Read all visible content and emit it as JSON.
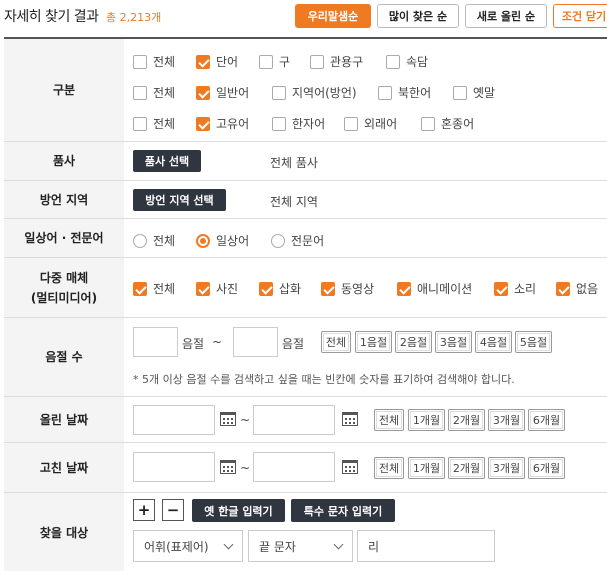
{
  "header": {
    "title": "자세히 찾기 결과",
    "total": "총 2,213개",
    "buttons": [
      "우리말샘순",
      "많이 찾은 순",
      "새로 올린 순",
      "조건 닫기"
    ]
  },
  "category": {
    "label": "구분",
    "row1": [
      {
        "text": "전체",
        "checked": false
      },
      {
        "text": "단어",
        "checked": true
      },
      {
        "text": "구",
        "checked": false
      },
      {
        "text": "관용구",
        "checked": false
      },
      {
        "text": "속담",
        "checked": false
      }
    ],
    "row2": [
      {
        "text": "전체",
        "checked": false
      },
      {
        "text": "일반어",
        "checked": true
      },
      {
        "text": "지역어(방언)",
        "checked": false
      },
      {
        "text": "북한어",
        "checked": false
      },
      {
        "text": "옛말",
        "checked": false
      }
    ],
    "row3": [
      {
        "text": "전체",
        "checked": false
      },
      {
        "text": "고유어",
        "checked": true
      },
      {
        "text": "한자어",
        "checked": false
      },
      {
        "text": "외래어",
        "checked": false
      },
      {
        "text": "혼종어",
        "checked": false
      }
    ]
  },
  "pos": {
    "label": "품사",
    "button": "품사 선택",
    "value": "전체 품사"
  },
  "region": {
    "label": "방언 지역",
    "button": "방언 지역 선택",
    "value": "전체 지역"
  },
  "register": {
    "label": "일상어 · 전문어",
    "options": [
      {
        "text": "전체",
        "selected": false
      },
      {
        "text": "일상어",
        "selected": true
      },
      {
        "text": "전문어",
        "selected": false
      }
    ]
  },
  "multimedia": {
    "label1": "다중 매체",
    "label2": "(멀티미디어)",
    "options": [
      {
        "text": "전체",
        "checked": true
      },
      {
        "text": "사진",
        "checked": true
      },
      {
        "text": "삽화",
        "checked": true
      },
      {
        "text": "동영상",
        "checked": true
      },
      {
        "text": "애니메이션",
        "checked": true
      },
      {
        "text": "소리",
        "checked": true
      },
      {
        "text": "없음",
        "checked": true
      }
    ]
  },
  "syllable": {
    "label": "음절 수",
    "unit": "음절",
    "tilde": "~",
    "chips": [
      "전체",
      "1음절",
      "2음절",
      "3음절",
      "4음절",
      "5음절"
    ],
    "note": "* 5개 이상 음절 수를 검색하고 싶을 때는 빈칸에 숫자를 표기하여 검색해야 합니다."
  },
  "posted": {
    "label": "올린 날짜",
    "tilde": "~",
    "chips": [
      "전체",
      "1개월",
      "2개월",
      "3개월",
      "6개월"
    ]
  },
  "modified": {
    "label": "고친 날짜",
    "tilde": "~",
    "chips": [
      "전체",
      "1개월",
      "2개월",
      "3개월",
      "6개월"
    ]
  },
  "target": {
    "label": "찾을 대상",
    "plus": "+",
    "minus": "−",
    "old_hangul": "옛 한글 입력기",
    "special": "특수 문자 입력기",
    "field_select": "어휘(표제어)",
    "match_select": "끝 문자",
    "query": "리"
  },
  "colors": {
    "accent": "#f07a22",
    "dark_button": "#2f3640",
    "label_bg": "#f4f4f4"
  }
}
